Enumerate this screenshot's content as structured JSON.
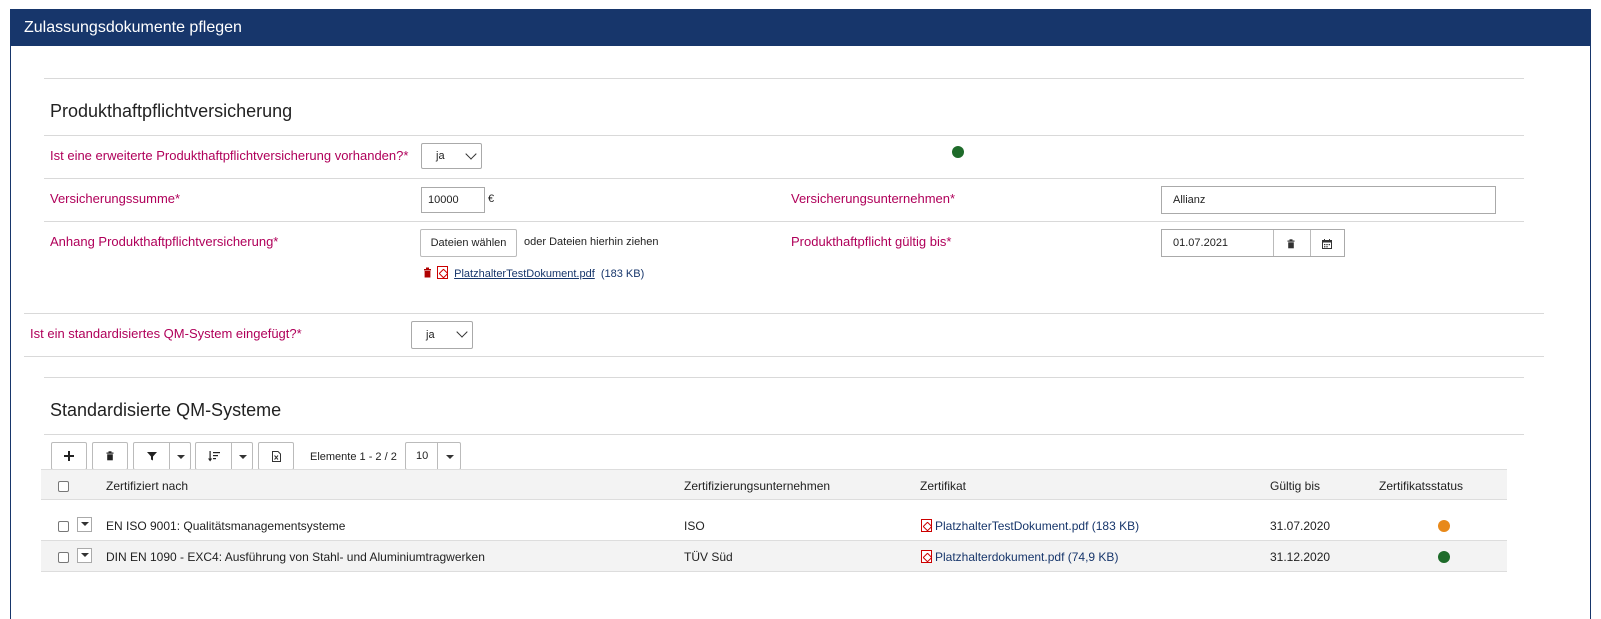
{
  "header": {
    "title": "Zulassungsdokumente pflegen"
  },
  "insurance": {
    "section_title": "Produkthaftpflichtversicherung",
    "extended_label": "Ist eine erweiterte Produkthaftpflichtversicherung vorhanden?*",
    "extended_value": "ja",
    "status_color": "#1e6b2a",
    "sum_label": "Versicherungssumme*",
    "sum_value": "10000",
    "currency": "€",
    "company_label": "Versicherungsunternehmen*",
    "company_value": "Allianz",
    "attachment_label": "Anhang Produkthaftpflichtversicherung*",
    "choose_files": "Dateien wählen",
    "drop_hint": "oder Dateien hierhin ziehen",
    "file_name": "PlatzhalterTestDokument.pdf",
    "file_size": "(183 KB)",
    "valid_label": "Produkthaftpflicht gültig bis*",
    "valid_value": "01.07.2021"
  },
  "qm": {
    "question_label": "Ist ein standardisiertes QM-System eingefügt?*",
    "question_value": "ja",
    "section_title": "Standardisierte QM-Systeme",
    "toolbar": {
      "items_text": "Elemente 1 - 2 / 2",
      "page_size": "10"
    },
    "table": {
      "columns": [
        "Zertifiziert nach",
        "Zertifizierungsunternehmen",
        "Zertifikat",
        "Gültig bis",
        "Zertifikatsstatus"
      ],
      "rows": [
        {
          "standard": "EN ISO 9001: Qualitätsmanagementsysteme",
          "company": "ISO",
          "certificate": "PlatzhalterTestDokument.pdf (183 KB)",
          "valid": "31.07.2020",
          "status_color": "#e8891a"
        },
        {
          "standard": "DIN EN 1090 - EXC4: Ausführung von Stahl- und Aluminiumtragwerken",
          "company": "TÜV Süd",
          "certificate": "Platzhalterdokument.pdf (74,9 KB)",
          "valid": "31.12.2020",
          "status_color": "#1e6b2a"
        }
      ]
    }
  },
  "colors": {
    "header_bg": "#17366b",
    "label": "#b0005a",
    "link": "#17366b"
  }
}
